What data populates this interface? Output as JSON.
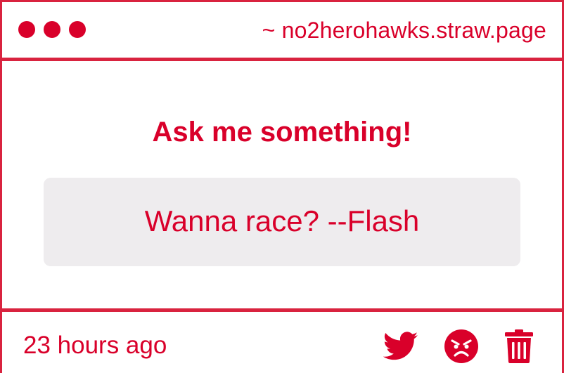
{
  "window": {
    "url": "~ no2herohawks.straw.page"
  },
  "main": {
    "prompt": "Ask me something!",
    "message": "Wanna race? --Flash"
  },
  "footer": {
    "timestamp": "23 hours ago",
    "actions": [
      {
        "icon": "twitter-icon"
      },
      {
        "icon": "angry-face-icon"
      },
      {
        "icon": "trash-icon"
      }
    ]
  },
  "colors": {
    "accent": "#d9002a",
    "border": "#d9233f",
    "message_bg": "#eeecee",
    "background": "#ffffff"
  }
}
